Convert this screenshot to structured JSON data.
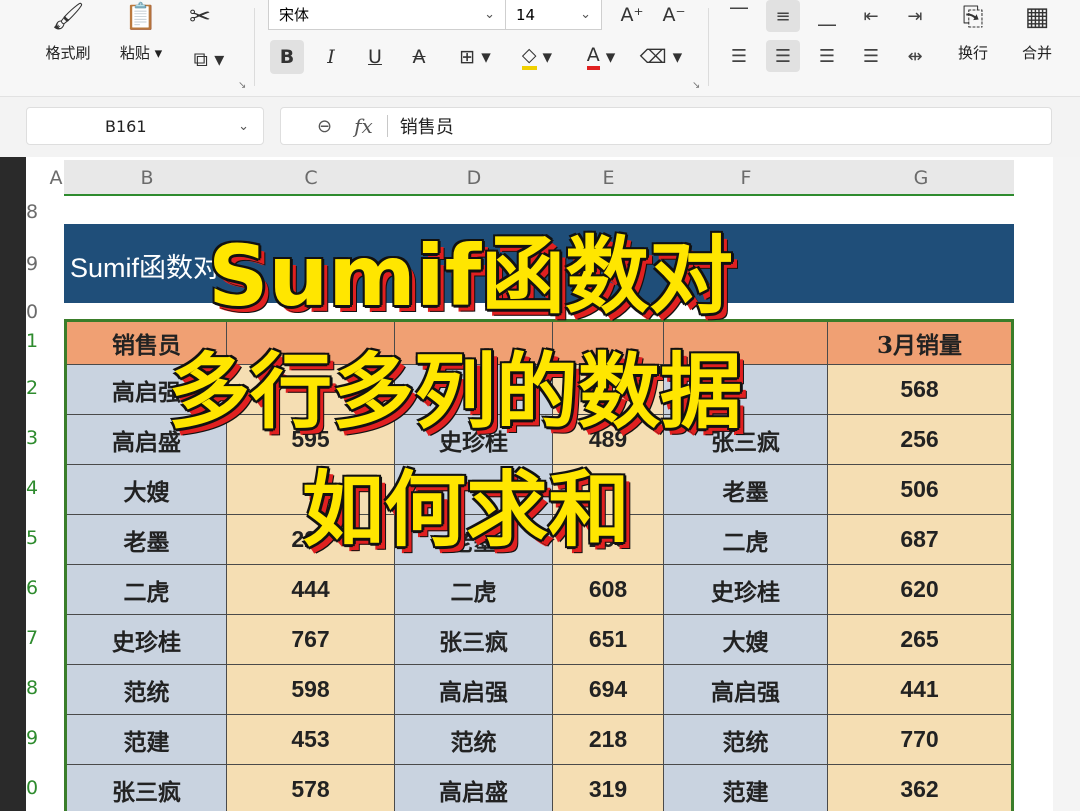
{
  "ribbon": {
    "format_painter": "格式刷",
    "paste": "粘贴",
    "font_name": "宋体",
    "font_size": "14",
    "wrap_text": "换行",
    "merge": "合并"
  },
  "formula_bar": {
    "name_box": "B161",
    "value": "销售员"
  },
  "columns": [
    "A",
    "B",
    "C",
    "D",
    "E",
    "F",
    "G"
  ],
  "rows": [
    "8",
    "9",
    "0",
    "1",
    "2",
    "3",
    "4",
    "5",
    "6",
    "7",
    "8",
    "9",
    "0"
  ],
  "title_band": "Sumif函数对",
  "table": {
    "header": [
      "销售员",
      "",
      "",
      "",
      "",
      "3月销量"
    ],
    "rows": [
      [
        "高启强",
        "",
        "",
        "",
        "",
        "568"
      ],
      [
        "高启盛",
        "595",
        "史珍桂",
        "489",
        "张三疯",
        "256"
      ],
      [
        "大嫂",
        "",
        "",
        "",
        "老墨",
        "506"
      ],
      [
        "老墨",
        "224",
        "老墨",
        "266",
        "二虎",
        "687"
      ],
      [
        "二虎",
        "444",
        "二虎",
        "608",
        "史珍桂",
        "620"
      ],
      [
        "史珍桂",
        "767",
        "张三疯",
        "651",
        "大嫂",
        "265"
      ],
      [
        "范统",
        "598",
        "高启强",
        "694",
        "高启强",
        "441"
      ],
      [
        "范建",
        "453",
        "范统",
        "218",
        "范统",
        "770"
      ],
      [
        "张三疯",
        "578",
        "高启盛",
        "319",
        "范建",
        "362"
      ]
    ]
  },
  "overlay": {
    "line1": "Sumif函数对",
    "line2": "多行多列的数据",
    "line3": "如何求和"
  }
}
